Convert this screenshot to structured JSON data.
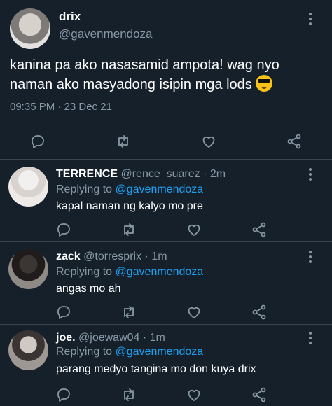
{
  "main_tweet": {
    "display_name": "drix",
    "handle": "@gavenmendoza",
    "text": "kanina pa ako nasasamid ampota! wag nyo naman ako masyadong isipin mga lods",
    "emoji": "sunglasses-face",
    "timestamp": "09:35 PM · 23 Dec 21"
  },
  "replies": [
    {
      "display_name": "TERRENCE",
      "handle": "@rence_suarez",
      "time": "· 2m",
      "replying_prefix": "Replying to",
      "replying_to": "@gavenmendoza",
      "text": "kapal naman ng kalyo mo pre"
    },
    {
      "display_name": "zack",
      "handle": "@torresprix",
      "time": "· 1m",
      "replying_prefix": "Replying to",
      "replying_to": "@gavenmendoza",
      "text": "angas mo ah"
    },
    {
      "display_name": "joe.",
      "handle": "@joewaw04",
      "time": "· 1m",
      "replying_prefix": "Replying to",
      "replying_to": "@gavenmendoza",
      "text": "parang medyo tangina mo don kuya drix"
    }
  ],
  "colors": {
    "background": "#15202b",
    "divider": "#38444d",
    "secondary_text": "#8899a6",
    "mention": "#1da1f2"
  },
  "icons": [
    "reply-icon",
    "retweet-icon",
    "like-icon",
    "share-icon",
    "more-options-icon"
  ]
}
